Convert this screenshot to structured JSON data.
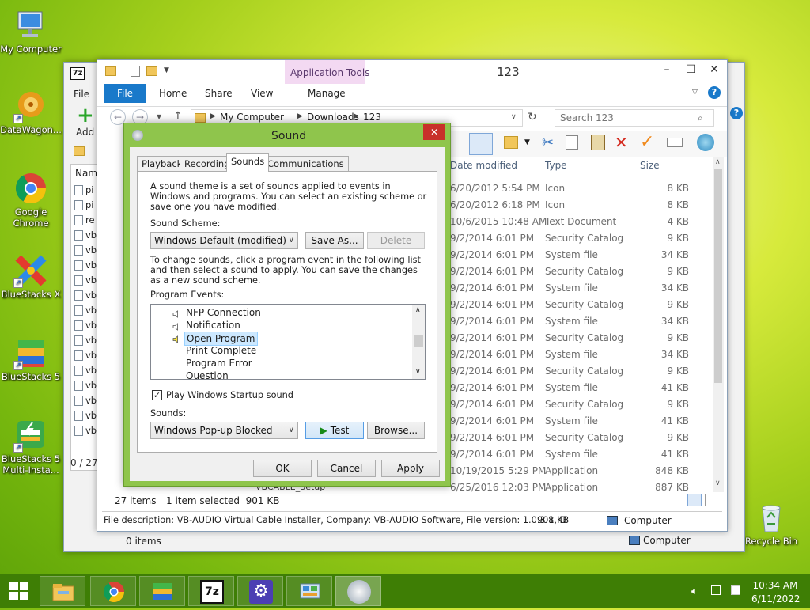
{
  "desktop": {
    "icons": [
      {
        "label": "My Computer"
      },
      {
        "label": "DataWagon..."
      },
      {
        "label": "Google Chrome"
      },
      {
        "label": "BlueStacks X"
      },
      {
        "label": "BlueStacks 5"
      },
      {
        "label": "BlueStacks 5 Multi-Insta..."
      },
      {
        "label": "Recycle Bin"
      }
    ]
  },
  "back_window": {
    "file_tab": "File",
    "add_label": "Add",
    "name_header": "Name",
    "truncated_rows": [
      "pi",
      "pi",
      "re",
      "vb",
      "vb",
      "vb",
      "vb",
      "vb",
      "vb",
      "vb",
      "vb",
      "vb",
      "vb",
      "vb",
      "vb",
      "vb",
      "vb"
    ],
    "status": "0 / 27 o",
    "bottom_status": "0 items",
    "bottom_location": "Computer"
  },
  "explorer": {
    "title": "123",
    "context_tab_group": "Application Tools",
    "tabs": {
      "file": "File",
      "home": "Home",
      "share": "Share",
      "view": "View",
      "manage": "Manage"
    },
    "breadcrumb": [
      "My Computer",
      "Downloads",
      "123"
    ],
    "search_placeholder": "Search 123",
    "columns": {
      "date": "Date modified",
      "type": "Type",
      "size": "Size"
    },
    "rows": [
      {
        "date": "6/20/2012 5:54 PM",
        "type": "Icon",
        "size": "8 KB"
      },
      {
        "date": "6/20/2012 6:18 PM",
        "type": "Icon",
        "size": "8 KB"
      },
      {
        "date": "10/6/2015 10:48 AM",
        "type": "Text Document",
        "size": "4 KB"
      },
      {
        "date": "9/2/2014 6:01 PM",
        "type": "Security Catalog",
        "size": "9 KB"
      },
      {
        "date": "9/2/2014 6:01 PM",
        "type": "System file",
        "size": "34 KB"
      },
      {
        "date": "9/2/2014 6:01 PM",
        "type": "Security Catalog",
        "size": "9 KB"
      },
      {
        "date": "9/2/2014 6:01 PM",
        "type": "System file",
        "size": "34 KB"
      },
      {
        "date": "9/2/2014 6:01 PM",
        "type": "Security Catalog",
        "size": "9 KB"
      },
      {
        "date": "9/2/2014 6:01 PM",
        "type": "System file",
        "size": "34 KB"
      },
      {
        "date": "9/2/2014 6:01 PM",
        "type": "Security Catalog",
        "size": "9 KB"
      },
      {
        "date": "9/2/2014 6:01 PM",
        "type": "System file",
        "size": "34 KB"
      },
      {
        "date": "9/2/2014 6:01 PM",
        "type": "Security Catalog",
        "size": "9 KB"
      },
      {
        "date": "9/2/2014 6:01 PM",
        "type": "System file",
        "size": "41 KB"
      },
      {
        "date": "9/2/2014 6:01 PM",
        "type": "Security Catalog",
        "size": "9 KB"
      },
      {
        "date": "9/2/2014 6:01 PM",
        "type": "System file",
        "size": "41 KB"
      },
      {
        "date": "9/2/2014 6:01 PM",
        "type": "Security Catalog",
        "size": "9 KB"
      },
      {
        "date": "9/2/2014 6:01 PM",
        "type": "System file",
        "size": "41 KB"
      },
      {
        "date": "10/19/2015 5:29 PM",
        "type": "Application",
        "size": "848 KB"
      },
      {
        "date": "6/25/2016 12:03 PM",
        "type": "Application",
        "size": "887 KB"
      }
    ],
    "hidden_name": "VBCABLE_Setup",
    "item_count": "27 items",
    "selected": "1 item selected  901 KB",
    "description": "File description: VB-AUDIO Virtual Cable Installer, Company: VB-AUDIO Software, File version: 1.0.3.8, D",
    "desc_size": "901 KB",
    "desc_location": "Computer"
  },
  "sound_dialog": {
    "title": "Sound",
    "tabs": [
      "Playback",
      "Recording",
      "Sounds",
      "Communications"
    ],
    "intro": "A sound theme is a set of sounds applied to events in Windows and programs.  You can select an existing scheme or save one you have modified.",
    "scheme_label": "Sound Scheme:",
    "scheme_value": "Windows Default (modified)",
    "save_as": "Save As...",
    "delete": "Delete",
    "change_text": "To change sounds, click a program event in the following list and then select a sound to apply.  You can save the changes as a new sound scheme.",
    "events_label": "Program Events:",
    "events": [
      {
        "label": "NFP Connection",
        "has_sound": true,
        "selected": false
      },
      {
        "label": "Notification",
        "has_sound": true,
        "selected": false
      },
      {
        "label": "Open Program",
        "has_sound": true,
        "selected": true
      },
      {
        "label": "Print Complete",
        "has_sound": false,
        "selected": false
      },
      {
        "label": "Program Error",
        "has_sound": false,
        "selected": false
      },
      {
        "label": "Question",
        "has_sound": false,
        "selected": false
      }
    ],
    "startup_label": "Play Windows Startup sound",
    "startup_checked": true,
    "sounds_label": "Sounds:",
    "sound_value": "Windows Pop-up Blocked",
    "test": "Test",
    "browse": "Browse...",
    "ok": "OK",
    "cancel": "Cancel",
    "apply": "Apply"
  },
  "taskbar": {
    "time": "10:34 AM",
    "date": "6/11/2022"
  },
  "colors": {
    "dialog_frame": "#8fc54c",
    "ribbon_file": "#1979ca",
    "selection": "#cce8ff",
    "taskbar": "#3e7e05"
  }
}
